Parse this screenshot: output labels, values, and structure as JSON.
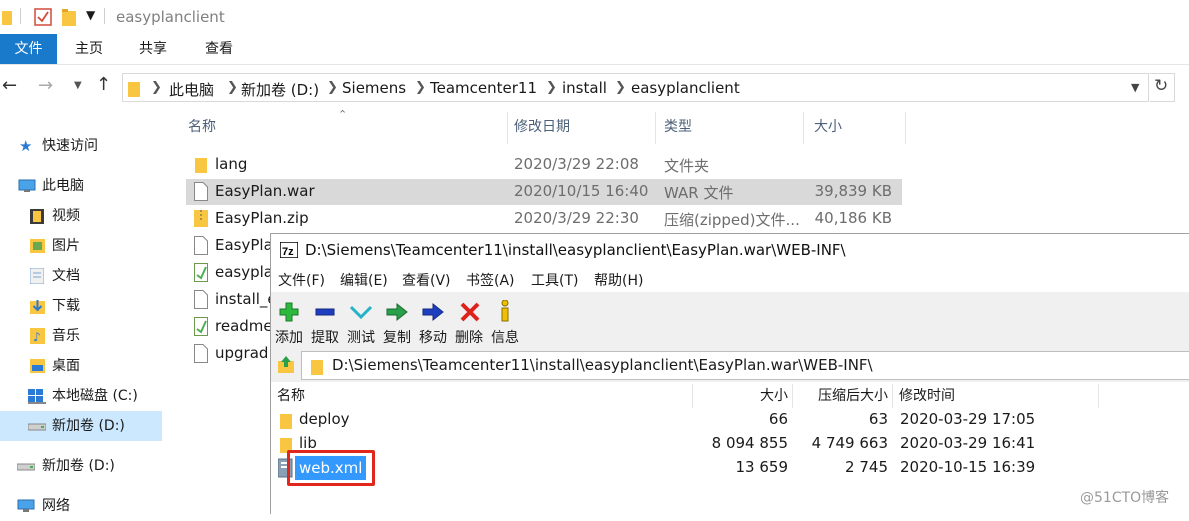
{
  "window": {
    "title": "easyplanclient"
  },
  "ribbon": {
    "tabs": [
      "文件",
      "主页",
      "共享",
      "查看"
    ]
  },
  "address": {
    "crumbs": [
      "此电脑",
      "新加卷 (D:)",
      "Siemens",
      "Teamcenter11",
      "install",
      "easyplanclient"
    ]
  },
  "sidebar": {
    "items": [
      "快速访问",
      "此电脑",
      "视频",
      "图片",
      "文档",
      "下载",
      "音乐",
      "桌面",
      "本地磁盘 (C:)",
      "新加卷 (D:)",
      "新加卷 (D:)",
      "网络"
    ]
  },
  "filelist": {
    "columns": [
      "名称",
      "修改日期",
      "类型",
      "大小"
    ],
    "rows": [
      {
        "name": "lang",
        "date": "2020/3/29 22:08",
        "type": "文件夹",
        "size": ""
      },
      {
        "name": "EasyPlan.war",
        "date": "2020/10/15 16:40",
        "type": "WAR 文件",
        "size": "39,839 KB"
      },
      {
        "name": "EasyPlan.zip",
        "date": "2020/3/29 22:30",
        "type": "压缩(zipped)文件...",
        "size": "40,186 KB"
      },
      {
        "name": "EasyPlan",
        "date": "",
        "type": "",
        "size": ""
      },
      {
        "name": "easypla",
        "date": "",
        "type": "",
        "size": ""
      },
      {
        "name": "install_e",
        "date": "",
        "type": "",
        "size": ""
      },
      {
        "name": "readme",
        "date": "",
        "type": "",
        "size": ""
      },
      {
        "name": "upgrad",
        "date": "",
        "type": "",
        "size": ""
      }
    ]
  },
  "zip": {
    "title": "D:\\Siemens\\Teamcenter11\\install\\easyplanclient\\EasyPlan.war\\WEB-INF\\",
    "menu": [
      "文件(F)",
      "编辑(E)",
      "查看(V)",
      "书签(A)",
      "工具(T)",
      "帮助(H)"
    ],
    "toolbar": [
      "添加",
      "提取",
      "测试",
      "复制",
      "移动",
      "删除",
      "信息"
    ],
    "path": "D:\\Siemens\\Teamcenter11\\install\\easyplanclient\\EasyPlan.war\\WEB-INF\\",
    "columns": [
      "名称",
      "大小",
      "压缩后大小",
      "修改时间"
    ],
    "rows": [
      {
        "name": "deploy",
        "size": "66",
        "packed": "63",
        "mtime": "2020-03-29 17:05"
      },
      {
        "name": "lib",
        "size": "8 094 855",
        "packed": "4 749 663",
        "mtime": "2020-03-29 16:41"
      },
      {
        "name": "web.xml",
        "size": "13 659",
        "packed": "2 745",
        "mtime": "2020-10-15 16:39"
      }
    ]
  },
  "watermark": "@51CTO博客",
  "colors": {
    "accent": "#1979ca",
    "folder": "#f8c640",
    "selection": "#cce8ff",
    "highlight_box": "#e1261c",
    "selected_item": "#3399ff"
  }
}
